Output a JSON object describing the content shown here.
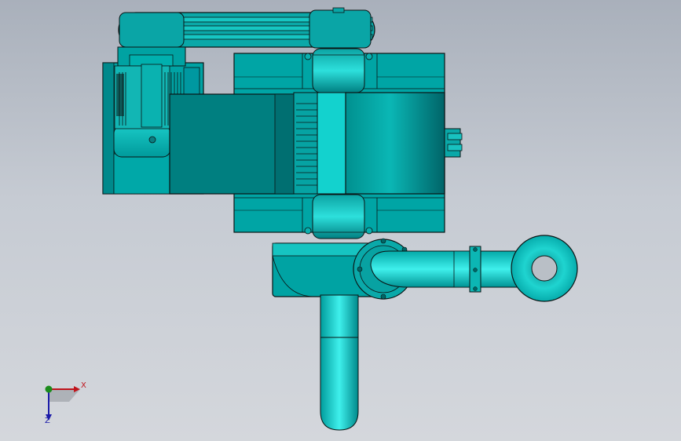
{
  "viewport": {
    "background_top": "#a9b0bb",
    "background_bottom": "#d4d7dc"
  },
  "model": {
    "body_color": "#00a5a5",
    "light_color": "#19d5d2",
    "dark_color": "#006c6e",
    "edge_color": "#0b1414"
  },
  "triad": {
    "x_label": "X",
    "z_label": "Z",
    "x_color": "#c0141c",
    "y_color": "#1c8c1c",
    "z_color": "#1a1aa8"
  }
}
